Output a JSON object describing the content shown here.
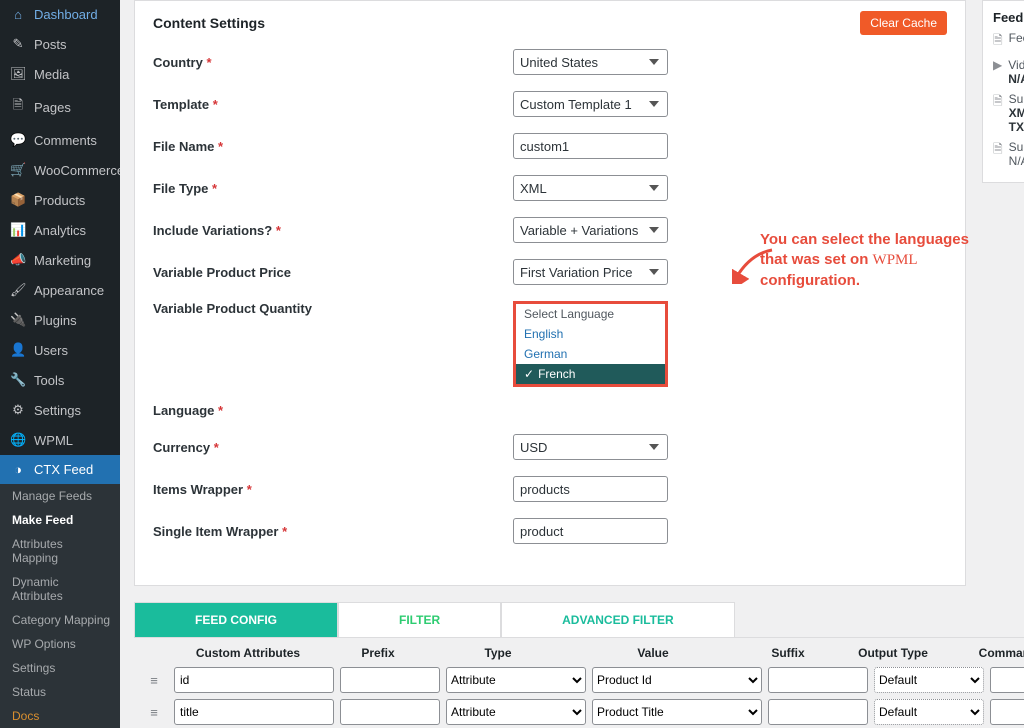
{
  "sidebar": {
    "items": [
      {
        "icon": "⌂",
        "label": "Dashboard"
      },
      {
        "icon": "✎",
        "label": "Posts"
      },
      {
        "icon": "🖼",
        "label": "Media"
      },
      {
        "icon": "🗎",
        "label": "Pages"
      },
      {
        "icon": "💬",
        "label": "Comments"
      },
      {
        "icon": "🛒",
        "label": "WooCommerce"
      },
      {
        "icon": "📦",
        "label": "Products"
      },
      {
        "icon": "📊",
        "label": "Analytics"
      },
      {
        "icon": "📣",
        "label": "Marketing"
      },
      {
        "icon": "🖌",
        "label": "Appearance"
      },
      {
        "icon": "🔌",
        "label": "Plugins"
      },
      {
        "icon": "👤",
        "label": "Users"
      },
      {
        "icon": "🔧",
        "label": "Tools"
      },
      {
        "icon": "⚙",
        "label": "Settings"
      },
      {
        "icon": "🌐",
        "label": "WPML"
      },
      {
        "icon": "◑",
        "label": "CTX Feed"
      }
    ],
    "submenu": [
      "Manage Feeds",
      "Make Feed",
      "Attributes Mapping",
      "Dynamic Attributes",
      "Category Mapping",
      "WP Options",
      "Settings",
      "Status",
      "Docs"
    ],
    "submenu_current_index": 1
  },
  "panel": {
    "title": "Content Settings",
    "clear_cache": "Clear Cache",
    "rows": {
      "country": {
        "label": "Country",
        "required": true,
        "value": "United States"
      },
      "template": {
        "label": "Template",
        "required": true,
        "value": "Custom Template 1"
      },
      "filename": {
        "label": "File Name",
        "required": true,
        "value": "custom1"
      },
      "filetype": {
        "label": "File Type",
        "required": true,
        "value": "XML"
      },
      "variations": {
        "label": "Include Variations?",
        "required": true,
        "value": "Variable + Variations"
      },
      "varprice": {
        "label": "Variable Product Price",
        "required": false,
        "value": "First Variation Price"
      },
      "varqty": {
        "label": "Variable Product Quantity",
        "required": false
      },
      "language": {
        "label": "Language",
        "required": true,
        "options": [
          "Select Language",
          "English",
          "German",
          "French"
        ],
        "selected_index": 3
      },
      "currency": {
        "label": "Currency",
        "required": true,
        "value": "USD"
      },
      "itemswrap": {
        "label": "Items Wrapper",
        "required": true,
        "value": "products"
      },
      "singlewrap": {
        "label": "Single Item Wrapper",
        "required": true,
        "value": "product"
      }
    }
  },
  "annotation": {
    "line1": "You can select the languages",
    "line2a": "that was set on ",
    "wpml": "WPML",
    "line3": "configuration."
  },
  "infobox": {
    "title": "Feed Merchant Info",
    "spec_label": "Feed Specification:",
    "spec_value": "N/A",
    "video_label": "Video Documentation:",
    "video_value": "N/A",
    "types_label": "Supported File Types:",
    "types_value": "XML, CSV, TSV, XLS, TXT, JSON",
    "docs_label": "Support Docs:",
    "docs_value": "N/A"
  },
  "tabs": {
    "config": "FEED CONFIG",
    "filter": "FILTER",
    "advanced": "ADVANCED FILTER"
  },
  "table": {
    "headers": {
      "attr": "Custom Attributes",
      "prefix": "Prefix",
      "type": "Type",
      "value": "Value",
      "suffix": "Suffix",
      "output": "Output Type",
      "cmd": "Command"
    },
    "rows": [
      {
        "attr": "id",
        "type": "Attribute",
        "value": "Product Id",
        "output": "Default"
      },
      {
        "attr": "title",
        "type": "Attribute",
        "value": "Product Title",
        "output": "Default"
      }
    ]
  }
}
